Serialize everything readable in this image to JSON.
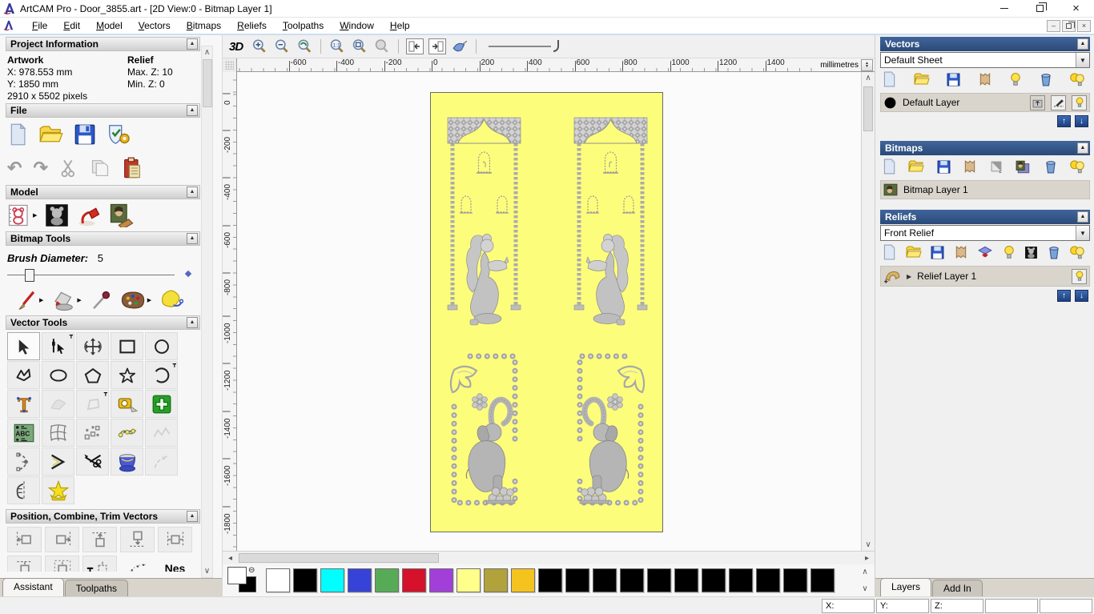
{
  "window": {
    "title": "ArtCAM Pro - Door_3855.art - [2D View:0 - Bitmap Layer 1]"
  },
  "menu": {
    "items": [
      "File",
      "Edit",
      "Model",
      "Vectors",
      "Bitmaps",
      "Reliefs",
      "Toolpaths",
      "Window",
      "Help"
    ]
  },
  "icons": {
    "undo": "↶",
    "redo": "↷",
    "scroll_up": "∧",
    "scroll_down": "∨",
    "scroll_left": "◂",
    "scroll_right": "▸",
    "collapse": "▲",
    "dropdown": "▼",
    "spin_up": "▲",
    "spin_down": "▼",
    "move_up": "↑",
    "move_down": "↓",
    "expand": "▶",
    "flyout": "▶",
    "pin": "┳",
    "link": "⊖",
    "close": "×"
  },
  "assistant": {
    "project": {
      "title": "Project Information",
      "artwork_heading": "Artwork",
      "relief_heading": "Relief",
      "x_value": "X: 978.553 mm",
      "max_z": "Max. Z: 10",
      "y_value": "Y: 1850 mm",
      "min_z": "Min. Z: 0",
      "pixels": "2910 x 5502 pixels"
    },
    "file_title": "File",
    "model_title": "Model",
    "bitmap_title": "Bitmap Tools",
    "brush_label": "Brush Diameter:",
    "brush_value": "5",
    "vector_title": "Vector Tools",
    "position_title": "Position, Combine, Trim Vectors",
    "nest_label": "Nes",
    "tabs": [
      "Assistant",
      "Toolpaths"
    ]
  },
  "canvas": {
    "btn_3d": "3D",
    "h_ticks": [
      -600,
      -400,
      -200,
      0,
      200,
      400,
      600,
      800,
      1000,
      1200,
      1400
    ],
    "v_ticks": [
      0,
      -200,
      -400,
      -600,
      -800,
      -1000,
      -1200,
      -1400,
      -1600,
      -1800
    ],
    "units": "millimetres"
  },
  "palette": {
    "colors": [
      "#ffffff",
      "#000000",
      "#00ffff",
      "#3743d8",
      "#58ab56",
      "#d5112b",
      "#a13fd8",
      "#ffff8a",
      "#b1a23c",
      "#f5c31d",
      "#000000",
      "#000000",
      "#000000",
      "#000000",
      "#000000",
      "#000000",
      "#000000",
      "#000000",
      "#000000",
      "#000000",
      "#000000"
    ]
  },
  "right_panel": {
    "vectors": {
      "title": "Vectors",
      "sheet": "Default Sheet",
      "layer": "Default Layer"
    },
    "bitmaps": {
      "title": "Bitmaps",
      "layer": "Bitmap Layer 1"
    },
    "reliefs": {
      "title": "Reliefs",
      "relief": "Front Relief",
      "layer": "Relief Layer 1"
    },
    "tabs": [
      "Layers",
      "Add In"
    ]
  },
  "status": {
    "x": "X:",
    "y": "Y:",
    "z": "Z:"
  }
}
